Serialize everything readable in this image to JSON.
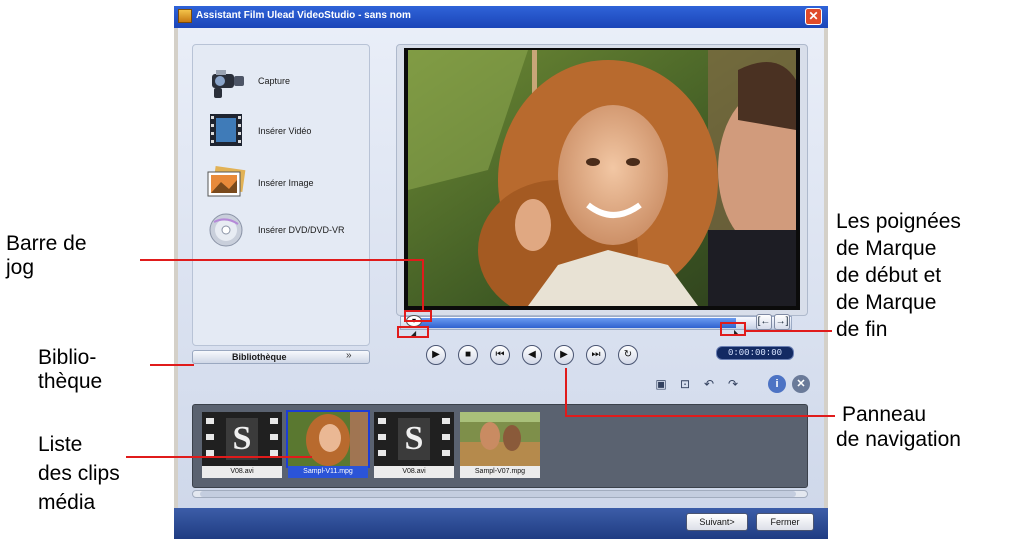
{
  "window": {
    "title": "Assistant Film Ulead VideoStudio - sans nom"
  },
  "left_panel": {
    "options": [
      {
        "label": "Capture",
        "icon": "camcorder-icon"
      },
      {
        "label": "Insérer Vidéo",
        "icon": "film-strip-icon"
      },
      {
        "label": "Insérer Image",
        "icon": "photo-icon"
      },
      {
        "label": "Insérer DVD/DVD-VR",
        "icon": "disc-icon"
      }
    ],
    "library_label": "Bibliothèque",
    "library_chevron": "»"
  },
  "preview": {
    "timecode": "0:00:00:00",
    "nav_buttons": [
      "play",
      "stop",
      "home",
      "previous-frame",
      "next-frame",
      "end",
      "repeat"
    ]
  },
  "clips": [
    {
      "name": "V08.avi",
      "kind": "film",
      "selected": false
    },
    {
      "name": "Sampl-V11.mpg",
      "kind": "photo",
      "selected": true
    },
    {
      "name": "V08.avi",
      "kind": "film",
      "selected": false
    },
    {
      "name": "Sampl-V07.mpg",
      "kind": "photo",
      "selected": false
    }
  ],
  "buttons": {
    "next": "Suivant>",
    "close": "Fermer"
  },
  "annotations": {
    "jog_bar": [
      "Barre de",
      "jog"
    ],
    "library": [
      "Biblio-",
      "thèque"
    ],
    "clip_list": [
      "Liste",
      "des clips",
      "média"
    ],
    "handles": [
      "Les poignées",
      "de Marque",
      "de début et",
      "de Marque",
      "de fin"
    ],
    "nav_panel": [
      "Panneau",
      "de navigation"
    ]
  },
  "colors": {
    "annotation_line": "#e01b1b",
    "title_bar": "#2f63d8",
    "bottom_bar": "#1f3c82"
  }
}
